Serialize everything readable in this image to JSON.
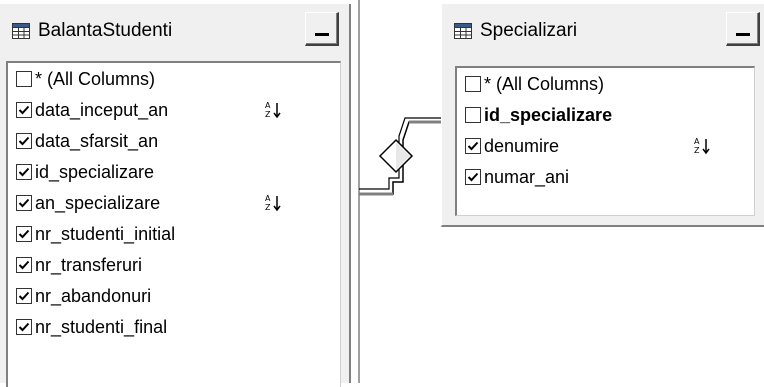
{
  "tables": {
    "left": {
      "title": "BalantaStudenti",
      "rows": [
        {
          "label": "* (All Columns)",
          "checked": false,
          "sort": false,
          "bold": false
        },
        {
          "label": "data_inceput_an",
          "checked": true,
          "sort": true,
          "bold": false
        },
        {
          "label": "data_sfarsit_an",
          "checked": true,
          "sort": false,
          "bold": false
        },
        {
          "label": "id_specializare",
          "checked": true,
          "sort": false,
          "bold": false
        },
        {
          "label": "an_specializare",
          "checked": true,
          "sort": true,
          "bold": false
        },
        {
          "label": "nr_studenti_initial",
          "checked": true,
          "sort": false,
          "bold": false
        },
        {
          "label": "nr_transferuri",
          "checked": true,
          "sort": false,
          "bold": false
        },
        {
          "label": "nr_abandonuri",
          "checked": true,
          "sort": false,
          "bold": false
        },
        {
          "label": "nr_studenti_final",
          "checked": true,
          "sort": false,
          "bold": false
        }
      ]
    },
    "right": {
      "title": "Specializari",
      "rows": [
        {
          "label": "* (All Columns)",
          "checked": false,
          "sort": false,
          "bold": false
        },
        {
          "label": "id_specializare",
          "checked": false,
          "sort": false,
          "bold": true
        },
        {
          "label": "denumire",
          "checked": true,
          "sort": true,
          "bold": false
        },
        {
          "label": "numar_ani",
          "checked": true,
          "sort": false,
          "bold": false
        }
      ]
    }
  },
  "icons": {
    "table": "table-grid-icon",
    "minimize": "minimize-icon",
    "sort": "sort-ascending-icon",
    "join": "join-diamond-icon"
  }
}
